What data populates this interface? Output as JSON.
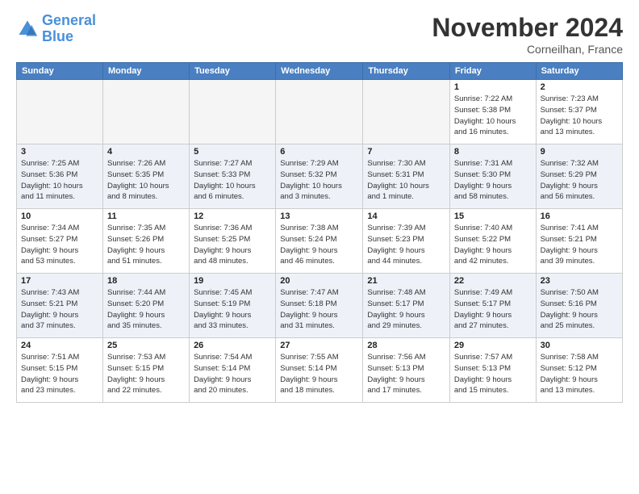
{
  "header": {
    "logo_line1": "General",
    "logo_line2": "Blue",
    "main_title": "November 2024",
    "subtitle": "Corneilhan, France"
  },
  "columns": [
    "Sunday",
    "Monday",
    "Tuesday",
    "Wednesday",
    "Thursday",
    "Friday",
    "Saturday"
  ],
  "weeks": [
    [
      {
        "day": "",
        "detail": ""
      },
      {
        "day": "",
        "detail": ""
      },
      {
        "day": "",
        "detail": ""
      },
      {
        "day": "",
        "detail": ""
      },
      {
        "day": "",
        "detail": ""
      },
      {
        "day": "1",
        "detail": "Sunrise: 7:22 AM\nSunset: 5:38 PM\nDaylight: 10 hours\nand 16 minutes."
      },
      {
        "day": "2",
        "detail": "Sunrise: 7:23 AM\nSunset: 5:37 PM\nDaylight: 10 hours\nand 13 minutes."
      }
    ],
    [
      {
        "day": "3",
        "detail": "Sunrise: 7:25 AM\nSunset: 5:36 PM\nDaylight: 10 hours\nand 11 minutes."
      },
      {
        "day": "4",
        "detail": "Sunrise: 7:26 AM\nSunset: 5:35 PM\nDaylight: 10 hours\nand 8 minutes."
      },
      {
        "day": "5",
        "detail": "Sunrise: 7:27 AM\nSunset: 5:33 PM\nDaylight: 10 hours\nand 6 minutes."
      },
      {
        "day": "6",
        "detail": "Sunrise: 7:29 AM\nSunset: 5:32 PM\nDaylight: 10 hours\nand 3 minutes."
      },
      {
        "day": "7",
        "detail": "Sunrise: 7:30 AM\nSunset: 5:31 PM\nDaylight: 10 hours\nand 1 minute."
      },
      {
        "day": "8",
        "detail": "Sunrise: 7:31 AM\nSunset: 5:30 PM\nDaylight: 9 hours\nand 58 minutes."
      },
      {
        "day": "9",
        "detail": "Sunrise: 7:32 AM\nSunset: 5:29 PM\nDaylight: 9 hours\nand 56 minutes."
      }
    ],
    [
      {
        "day": "10",
        "detail": "Sunrise: 7:34 AM\nSunset: 5:27 PM\nDaylight: 9 hours\nand 53 minutes."
      },
      {
        "day": "11",
        "detail": "Sunrise: 7:35 AM\nSunset: 5:26 PM\nDaylight: 9 hours\nand 51 minutes."
      },
      {
        "day": "12",
        "detail": "Sunrise: 7:36 AM\nSunset: 5:25 PM\nDaylight: 9 hours\nand 48 minutes."
      },
      {
        "day": "13",
        "detail": "Sunrise: 7:38 AM\nSunset: 5:24 PM\nDaylight: 9 hours\nand 46 minutes."
      },
      {
        "day": "14",
        "detail": "Sunrise: 7:39 AM\nSunset: 5:23 PM\nDaylight: 9 hours\nand 44 minutes."
      },
      {
        "day": "15",
        "detail": "Sunrise: 7:40 AM\nSunset: 5:22 PM\nDaylight: 9 hours\nand 42 minutes."
      },
      {
        "day": "16",
        "detail": "Sunrise: 7:41 AM\nSunset: 5:21 PM\nDaylight: 9 hours\nand 39 minutes."
      }
    ],
    [
      {
        "day": "17",
        "detail": "Sunrise: 7:43 AM\nSunset: 5:21 PM\nDaylight: 9 hours\nand 37 minutes."
      },
      {
        "day": "18",
        "detail": "Sunrise: 7:44 AM\nSunset: 5:20 PM\nDaylight: 9 hours\nand 35 minutes."
      },
      {
        "day": "19",
        "detail": "Sunrise: 7:45 AM\nSunset: 5:19 PM\nDaylight: 9 hours\nand 33 minutes."
      },
      {
        "day": "20",
        "detail": "Sunrise: 7:47 AM\nSunset: 5:18 PM\nDaylight: 9 hours\nand 31 minutes."
      },
      {
        "day": "21",
        "detail": "Sunrise: 7:48 AM\nSunset: 5:17 PM\nDaylight: 9 hours\nand 29 minutes."
      },
      {
        "day": "22",
        "detail": "Sunrise: 7:49 AM\nSunset: 5:17 PM\nDaylight: 9 hours\nand 27 minutes."
      },
      {
        "day": "23",
        "detail": "Sunrise: 7:50 AM\nSunset: 5:16 PM\nDaylight: 9 hours\nand 25 minutes."
      }
    ],
    [
      {
        "day": "24",
        "detail": "Sunrise: 7:51 AM\nSunset: 5:15 PM\nDaylight: 9 hours\nand 23 minutes."
      },
      {
        "day": "25",
        "detail": "Sunrise: 7:53 AM\nSunset: 5:15 PM\nDaylight: 9 hours\nand 22 minutes."
      },
      {
        "day": "26",
        "detail": "Sunrise: 7:54 AM\nSunset: 5:14 PM\nDaylight: 9 hours\nand 20 minutes."
      },
      {
        "day": "27",
        "detail": "Sunrise: 7:55 AM\nSunset: 5:14 PM\nDaylight: 9 hours\nand 18 minutes."
      },
      {
        "day": "28",
        "detail": "Sunrise: 7:56 AM\nSunset: 5:13 PM\nDaylight: 9 hours\nand 17 minutes."
      },
      {
        "day": "29",
        "detail": "Sunrise: 7:57 AM\nSunset: 5:13 PM\nDaylight: 9 hours\nand 15 minutes."
      },
      {
        "day": "30",
        "detail": "Sunrise: 7:58 AM\nSunset: 5:12 PM\nDaylight: 9 hours\nand 13 minutes."
      }
    ]
  ]
}
